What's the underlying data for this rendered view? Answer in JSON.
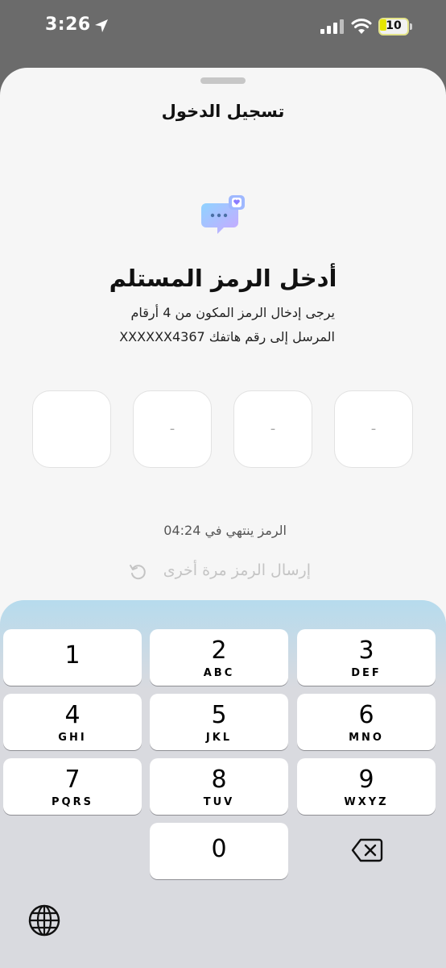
{
  "status_bar": {
    "time": "3:26",
    "battery_level": "10"
  },
  "sheet": {
    "title": "تسجيل الدخول"
  },
  "otp": {
    "heading": "أدخل الرمز المستلم",
    "instruction_line1": "يرجى إدخال الرمز المكون من 4 أرقام",
    "instruction_line2": "المرسل إلى رقم هاتفك XXXXXX4367",
    "boxes": [
      "",
      "-",
      "-",
      "-"
    ],
    "expiry_text": "الرمز ينتهي في 04:24",
    "resend_label": "إرسال الرمز مرة أخرى"
  },
  "keypad": {
    "keys": [
      {
        "num": "1",
        "letters": ""
      },
      {
        "num": "2",
        "letters": "ABC"
      },
      {
        "num": "3",
        "letters": "DEF"
      },
      {
        "num": "4",
        "letters": "GHI"
      },
      {
        "num": "5",
        "letters": "JKL"
      },
      {
        "num": "6",
        "letters": "MNO"
      },
      {
        "num": "7",
        "letters": "PQRS"
      },
      {
        "num": "8",
        "letters": "TUV"
      },
      {
        "num": "9",
        "letters": "WXYZ"
      },
      {
        "num": "0",
        "letters": ""
      }
    ]
  },
  "colors": {
    "sheet_background": "#f6f6f6",
    "keyboard_background": "#d9dadf",
    "icon_gradient_start": "#8fd3ff",
    "icon_gradient_end": "#c9a8ff",
    "disabled_text": "#c4c4c4"
  },
  "icons": {
    "location": "location-arrow-icon",
    "signal": "cellular-signal-icon",
    "wifi": "wifi-icon",
    "chat": "chat-bubble-icon",
    "resend": "refresh-icon",
    "delete": "delete-backspace-icon",
    "globe": "globe-icon"
  }
}
